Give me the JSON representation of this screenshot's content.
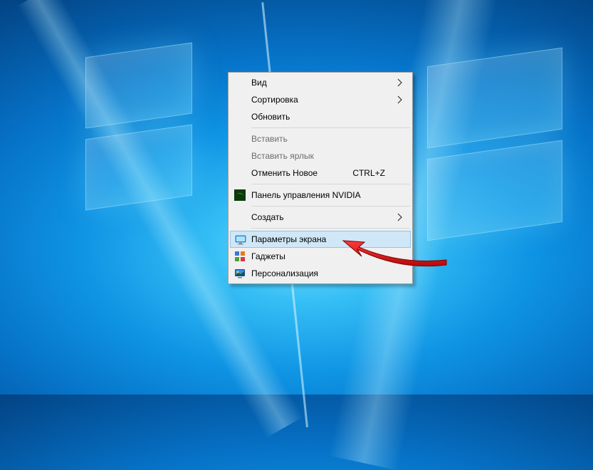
{
  "context_menu": {
    "items": {
      "view": {
        "label": "Вид",
        "has_submenu": true,
        "disabled": false
      },
      "sort": {
        "label": "Сортировка",
        "has_submenu": true,
        "disabled": false
      },
      "refresh": {
        "label": "Обновить",
        "has_submenu": false,
        "disabled": false
      },
      "paste": {
        "label": "Вставить",
        "has_submenu": false,
        "disabled": true
      },
      "paste_short": {
        "label": "Вставить ярлык",
        "has_submenu": false,
        "disabled": true
      },
      "undo_new": {
        "label": "Отменить Новое",
        "has_submenu": false,
        "disabled": false,
        "shortcut": "CTRL+Z"
      },
      "nvidia": {
        "label": "Панель управления NVIDIA",
        "has_submenu": false,
        "disabled": false,
        "icon": "nvidia-icon"
      },
      "create": {
        "label": "Создать",
        "has_submenu": true,
        "disabled": false
      },
      "display": {
        "label": "Параметры экрана",
        "has_submenu": false,
        "disabled": false,
        "icon": "monitor-icon",
        "highlighted": true
      },
      "gadgets": {
        "label": "Гаджеты",
        "has_submenu": false,
        "disabled": false,
        "icon": "gadgets-icon"
      },
      "personalize": {
        "label": "Персонализация",
        "has_submenu": false,
        "disabled": false,
        "icon": "personalize-icon"
      }
    }
  }
}
